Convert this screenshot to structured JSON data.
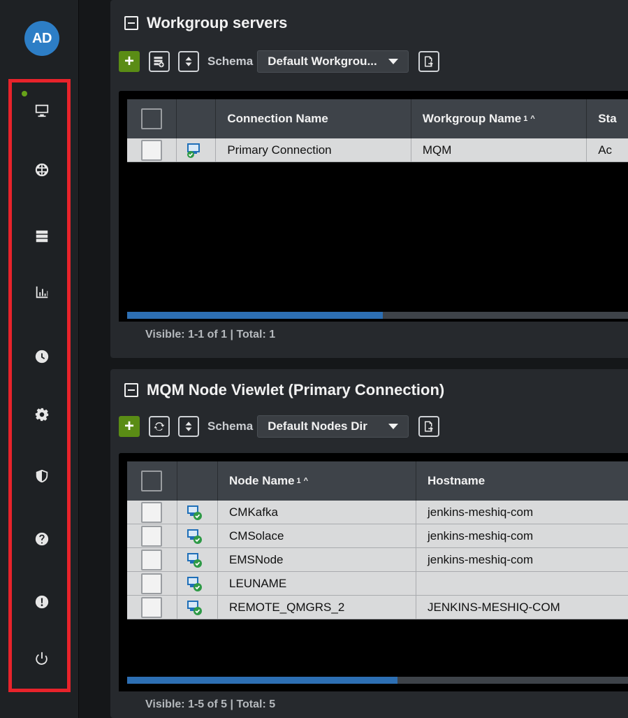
{
  "user": {
    "initials": "AD"
  },
  "sidebar": {
    "items": [
      {
        "name": "monitor",
        "icon": "monitor-icon"
      },
      {
        "name": "globe",
        "icon": "globe-icon"
      },
      {
        "name": "servers",
        "icon": "server-icon"
      },
      {
        "name": "charts",
        "icon": "bar-chart-icon"
      },
      {
        "name": "history",
        "icon": "clock-icon"
      },
      {
        "name": "settings",
        "icon": "gear-icon"
      },
      {
        "name": "security",
        "icon": "shield-icon"
      },
      {
        "name": "help",
        "icon": "question-icon"
      },
      {
        "name": "alerts",
        "icon": "exclamation-icon"
      },
      {
        "name": "logout",
        "icon": "power-icon"
      }
    ]
  },
  "workgroup_panel": {
    "title": "Workgroup servers",
    "schema_label": "Schema",
    "schema_value": "Default Workgrou...",
    "columns": [
      "Connection Name",
      "Workgroup Name",
      "Sta"
    ],
    "sort_index": "1",
    "sort_arrow": "^",
    "rows": [
      {
        "connection": "Primary Connection",
        "workgroup": "MQM",
        "status": "Ac"
      }
    ],
    "footer": "Visible: 1-1 of 1 | Total: 1",
    "scroll_fraction": 0.51
  },
  "node_panel": {
    "title": "MQM Node Viewlet (Primary Connection)",
    "schema_label": "Schema",
    "schema_value": "Default Nodes Dir",
    "columns": [
      "Node Name",
      "Hostname"
    ],
    "sort_index": "1",
    "sort_arrow": "^",
    "rows": [
      {
        "node": "CMKafka",
        "host": "jenkins-meshiq-com"
      },
      {
        "node": "CMSolace",
        "host": "jenkins-meshiq-com"
      },
      {
        "node": "EMSNode",
        "host": "jenkins-meshiq-com"
      },
      {
        "node": "LEUNAME",
        "host": ""
      },
      {
        "node": "REMOTE_QMGRS_2",
        "host": "JENKINS-MESHIQ-COM"
      }
    ],
    "footer": "Visible: 1-5 of 5 | Total: 5",
    "scroll_fraction": 0.54
  },
  "colors": {
    "accent_green": "#5a8c15",
    "status_dot": "#67a319",
    "highlight_red": "#e8232b",
    "scroll_blue": "#2d6fb3"
  }
}
